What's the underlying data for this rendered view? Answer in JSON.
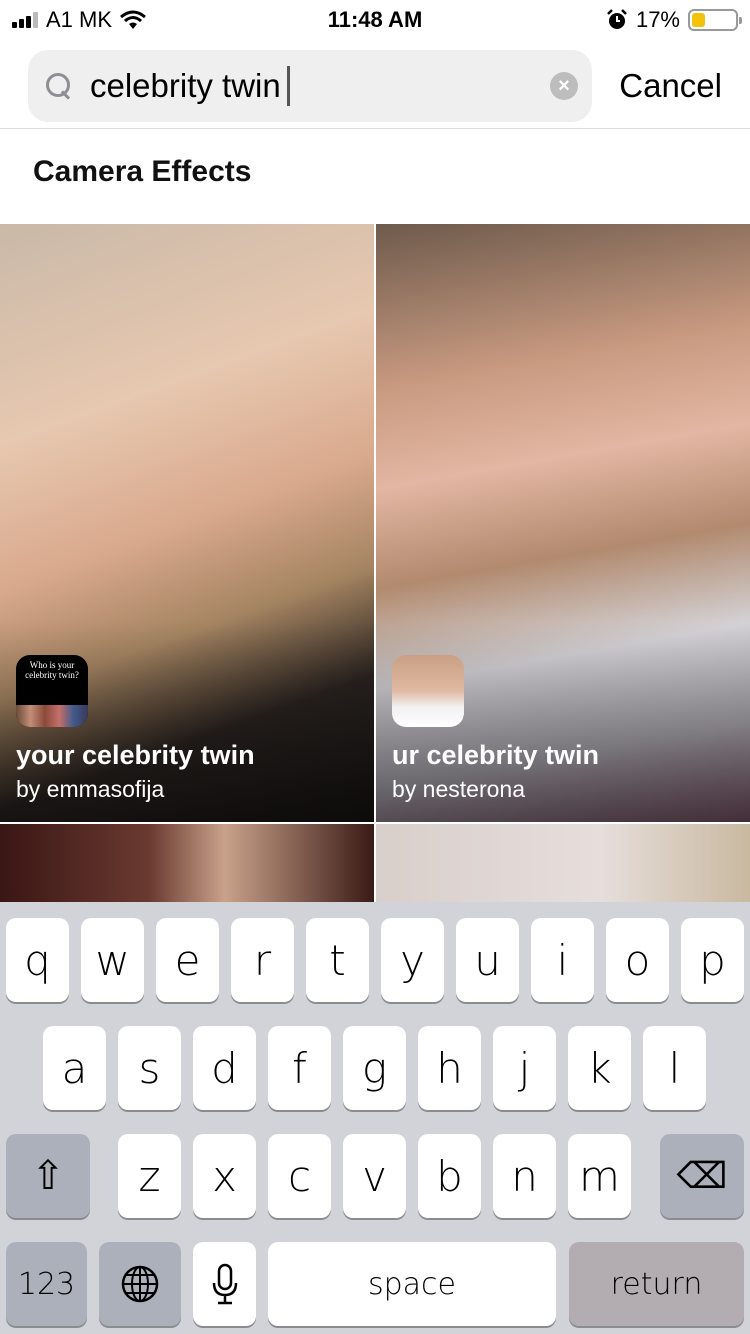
{
  "status_bar": {
    "carrier": "A1 MK",
    "time": "11:48 AM",
    "battery_percent_label": "17%",
    "battery_level": 0.17,
    "signal_bars": 3,
    "icons": [
      "signal-icon",
      "wifi-icon",
      "alarm-icon",
      "battery-icon"
    ]
  },
  "search": {
    "value": "celebrity twin",
    "clear_icon": "×",
    "cancel_label": "Cancel"
  },
  "section": {
    "title": "Camera Effects"
  },
  "effects": [
    {
      "name": "your celebrity twin",
      "author": "by emmasofija",
      "thumb_text": "Who is your celebrity twin?"
    },
    {
      "name": "ur celebrity twin",
      "author": "by nesterona"
    }
  ],
  "keyboard": {
    "row1": [
      "q",
      "w",
      "e",
      "r",
      "t",
      "y",
      "u",
      "i",
      "o",
      "p"
    ],
    "row2": [
      "a",
      "s",
      "d",
      "f",
      "g",
      "h",
      "j",
      "k",
      "l"
    ],
    "row3": [
      "z",
      "x",
      "c",
      "v",
      "b",
      "n",
      "m"
    ],
    "shift_icon": "⇧",
    "delete_icon": "⌫",
    "numbers_label": "123",
    "globe_icon": "🌐",
    "mic_icon": "🎙",
    "space_label": "space",
    "return_label": "return"
  }
}
